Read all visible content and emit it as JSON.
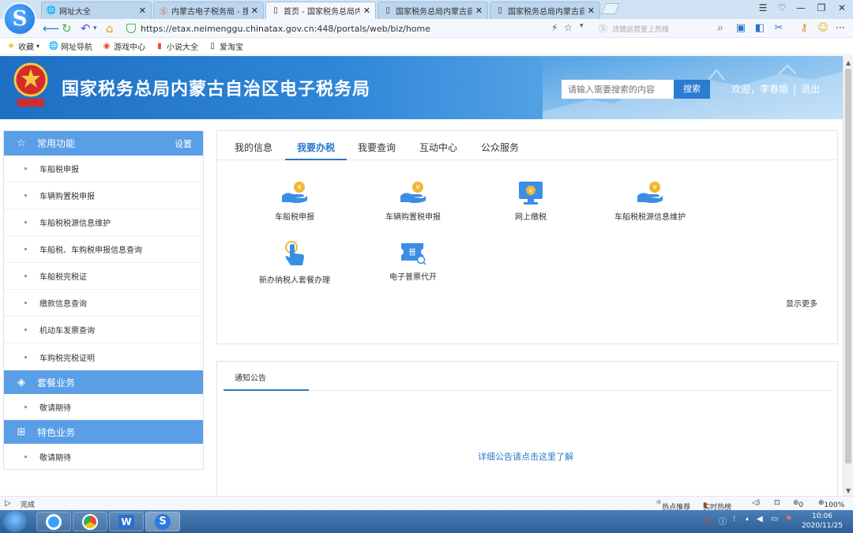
{
  "browser": {
    "tabs": [
      {
        "label": "网址大全",
        "active": false
      },
      {
        "label": "内蒙古电子税务局 - 搜狗",
        "active": false
      },
      {
        "label": "首页 - 国家税务总局内蒙",
        "active": true
      },
      {
        "label": "国家税务总局内蒙古自治",
        "active": false
      },
      {
        "label": "国家税务总局内蒙古自治",
        "active": false
      }
    ],
    "url": "https://etax.neimenggu.chinatax.gov.cn:448/portals/web/biz/home",
    "search_placeholder": "滤镜运营登上热搜",
    "bookmarks": [
      {
        "label": "收藏"
      },
      {
        "label": "网址导航"
      },
      {
        "label": "游戏中心"
      },
      {
        "label": "小说大全"
      },
      {
        "label": "爱淘宝"
      }
    ]
  },
  "header": {
    "title": "国家税务总局内蒙古自治区电子税务局",
    "search_placeholder": "请输入需要搜索的内容",
    "search_button": "搜索",
    "welcome": "欢迎，李春娥",
    "logout": "退出"
  },
  "sidebar": {
    "groups": [
      {
        "title": "常用功能",
        "setting": "设置",
        "items": [
          "车船税申报",
          "车辆购置税申报",
          "车船税税源信息维护",
          "车船税、车购税申报信息查询",
          "车船税完税证",
          "缴款信息查询",
          "机动车发票查询",
          "车购税完税证明"
        ]
      },
      {
        "title": "套餐业务",
        "items": [
          "敬请期待"
        ]
      },
      {
        "title": "特色业务",
        "items": [
          "敬请期待"
        ]
      }
    ]
  },
  "main": {
    "tabs": [
      "我的信息",
      "我要办税",
      "我要查询",
      "互动中心",
      "公众服务"
    ],
    "active_tab": "我要办税",
    "functions": [
      {
        "label": "车船税申报",
        "icon": "hand-coin-icon"
      },
      {
        "label": "车辆购置税申报",
        "icon": "hand-coin-icon"
      },
      {
        "label": "网上缴税",
        "icon": "monitor-coin-icon"
      },
      {
        "label": "车船税税源信息维护",
        "icon": "hand-coin-icon"
      },
      {
        "label": "新办纳税人套餐办理",
        "icon": "pointer-hand-icon"
      },
      {
        "label": "电子普票代开",
        "icon": "invoice-ticket-icon",
        "badge": "普"
      }
    ],
    "more": "显示更多"
  },
  "notice": {
    "tab": "通知公告",
    "link": "详细公告请点击这里了解"
  },
  "statusbar": {
    "status": "完成",
    "hot_recommend": "热点推荐",
    "realtime_hot": "实时热榜",
    "zero_count": "0",
    "zoom": "100%"
  },
  "taskbar": {
    "time": "10:06",
    "date": "2020/11/25"
  },
  "colors": {
    "accent": "#2b77c9",
    "sidebar_head": "#5a9ee6",
    "icon_blue": "#3a8ee6",
    "icon_gold": "#f2b632"
  }
}
